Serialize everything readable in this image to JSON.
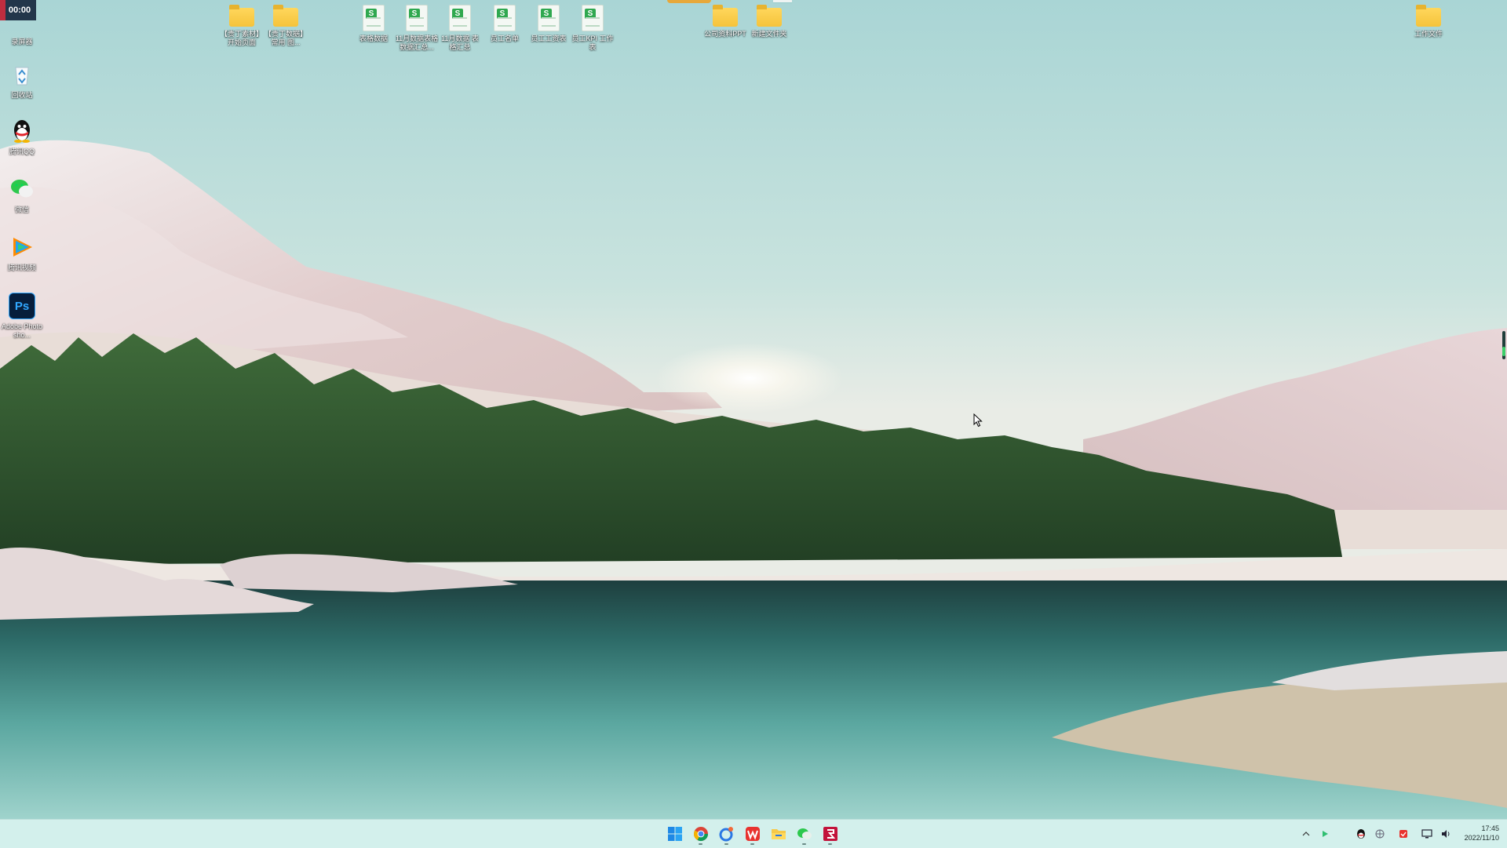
{
  "recorder": {
    "elapsed": "00:00"
  },
  "desktop_left": [
    {
      "label": "录屏器",
      "icon": "screen-recorder-icon"
    },
    {
      "label": "回收站",
      "icon": "recycle-bin-icon"
    },
    {
      "label": "腾讯QQ",
      "icon": "qq-icon"
    },
    {
      "label": "微信",
      "icon": "wechat-icon"
    },
    {
      "label": "腾讯视频",
      "icon": "tencent-video-icon"
    },
    {
      "label": "Adobe Photosho...",
      "icon": "photoshop-icon",
      "icon_text": "Ps"
    }
  ],
  "desktop_top": [
    {
      "label": "【贵丁素材】开始页面",
      "type": "folder"
    },
    {
      "label": "【贵丁数据】常用 图...",
      "type": "folder"
    },
    {
      "label": "表格数据",
      "type": "sheet",
      "badge": "S"
    },
    {
      "label": "11月数据表格 数据汇总...",
      "type": "sheet",
      "badge": "S"
    },
    {
      "label": "11月数据 表格汇总",
      "type": "sheet",
      "badge": "S"
    },
    {
      "label": "员工名单",
      "type": "sheet",
      "badge": "S"
    },
    {
      "label": "员工工资表",
      "type": "sheet",
      "badge": "S"
    },
    {
      "label": "员工KPI 工作表",
      "type": "sheet",
      "badge": "S"
    },
    {
      "label": "公司资料PPT",
      "type": "folder"
    },
    {
      "label": "新建文件夹",
      "type": "folder"
    }
  ],
  "desktop_right": [
    {
      "label": "工作文件",
      "type": "folder"
    }
  ],
  "taskbar": {
    "apps": [
      {
        "name": "start-button",
        "icon": "windows-logo-icon",
        "active": false
      },
      {
        "name": "chrome-button",
        "icon": "chrome-icon",
        "active": true
      },
      {
        "name": "browser-button",
        "icon": "sogou-browser-icon",
        "active": true
      },
      {
        "name": "wps-button",
        "icon": "wps-office-icon",
        "active": true
      },
      {
        "name": "file-explorer-button",
        "icon": "file-explorer-icon",
        "active": false
      },
      {
        "name": "wechat-button",
        "icon": "wechat-icon",
        "active": true
      },
      {
        "name": "recorder-button",
        "icon": "recorder-app-icon",
        "active": true
      }
    ],
    "tray": [
      {
        "icon": "chevron-up-icon"
      },
      {
        "icon": "green-status-icon"
      },
      {
        "icon": "qq-tray-icon"
      },
      {
        "icon": "input-method-icon"
      },
      {
        "icon": "security-icon"
      },
      {
        "icon": "network-icon"
      },
      {
        "icon": "volume-icon"
      }
    ],
    "time": "17:45",
    "date": "2022/11/10"
  },
  "colors": {
    "taskbar_bg": "#d4f0ec",
    "folder": "#f5c33b",
    "sheet_badge": "#2fa84f",
    "recorder": "#c02d3f"
  }
}
